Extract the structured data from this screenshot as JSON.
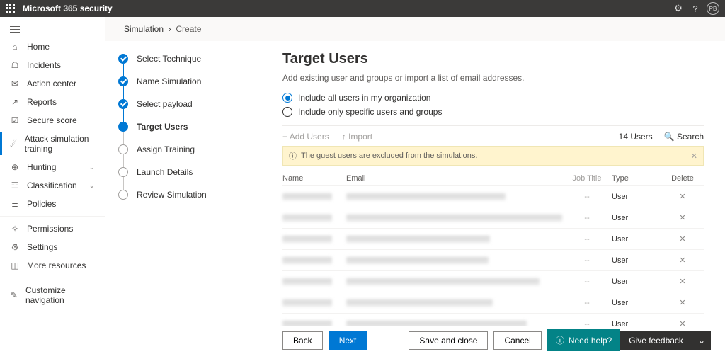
{
  "top": {
    "product": "Microsoft 365 security",
    "avatar": "PB"
  },
  "sidebar": {
    "items": [
      {
        "label": "Home"
      },
      {
        "label": "Incidents"
      },
      {
        "label": "Action center"
      },
      {
        "label": "Reports"
      },
      {
        "label": "Secure score"
      },
      {
        "label": "Attack simulation training"
      },
      {
        "label": "Hunting"
      },
      {
        "label": "Classification"
      },
      {
        "label": "Policies"
      },
      {
        "label": "Permissions"
      },
      {
        "label": "Settings"
      },
      {
        "label": "More resources"
      },
      {
        "label": "Customize navigation"
      }
    ]
  },
  "breadcrumb": {
    "root": "Simulation",
    "current": "Create"
  },
  "steps": [
    {
      "label": "Select Technique",
      "state": "done"
    },
    {
      "label": "Name Simulation",
      "state": "done"
    },
    {
      "label": "Select payload",
      "state": "done"
    },
    {
      "label": "Target Users",
      "state": "current"
    },
    {
      "label": "Assign Training",
      "state": "todo"
    },
    {
      "label": "Launch Details",
      "state": "todo"
    },
    {
      "label": "Review Simulation",
      "state": "todo"
    }
  ],
  "panel": {
    "title": "Target Users",
    "subtitle": "Add existing user and groups or import a list of email addresses.",
    "radio1": "Include all users in my organization",
    "radio2": "Include only specific users and groups",
    "addUsers": "Add Users",
    "import": "Import",
    "count": "14 Users",
    "search": "Search",
    "info": "The guest users are excluded from the simulations.",
    "cols": {
      "name": "Name",
      "email": "Email",
      "job": "Job Title",
      "type": "Type",
      "del": "Delete"
    },
    "rows": [
      {
        "job": "--",
        "type": "User"
      },
      {
        "job": "--",
        "type": "User"
      },
      {
        "job": "--",
        "type": "User"
      },
      {
        "job": "--",
        "type": "User"
      },
      {
        "job": "--",
        "type": "User"
      },
      {
        "job": "--",
        "type": "User"
      },
      {
        "job": "--",
        "type": "User"
      }
    ]
  },
  "footer": {
    "back": "Back",
    "next": "Next",
    "save": "Save and close",
    "cancel": "Cancel",
    "help": "Need help?",
    "feedback": "Give feedback"
  }
}
